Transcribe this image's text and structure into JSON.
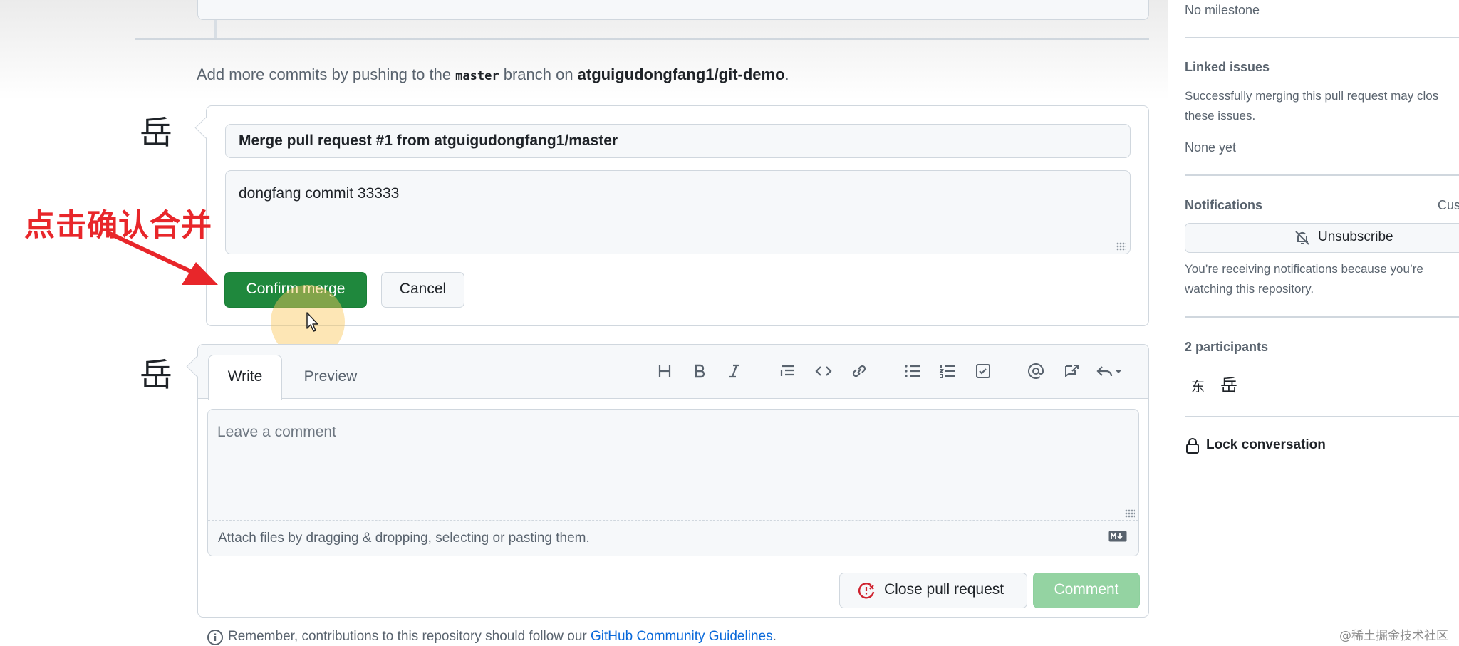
{
  "hint": {
    "prefix": "Add more commits by pushing to the ",
    "branch": "master",
    "middle": " branch on ",
    "repo": "atguigudongfang1/git-demo",
    "suffix": "."
  },
  "avatars": {
    "merge_author": "岳",
    "comment_author": "岳"
  },
  "annotation": {
    "text": "点击确认合并",
    "color": "#e8262a"
  },
  "merge": {
    "title_value": "Merge pull request #1 from atguigudongfang1/master",
    "message_value": "dongfang commit 33333",
    "confirm_label": "Confirm merge",
    "cancel_label": "Cancel"
  },
  "comment": {
    "tabs": [
      "Write",
      "Preview"
    ],
    "active_tab": "Write",
    "toolbar_icons": [
      "heading-icon",
      "bold-icon",
      "italic-icon",
      "quote-icon",
      "code-icon",
      "link-icon",
      "unordered-list-icon",
      "ordered-list-icon",
      "task-list-icon",
      "mention-icon",
      "reference-icon",
      "reply-icon"
    ],
    "placeholder": "Leave a comment",
    "attach_text": "Attach files by dragging & dropping, selecting or pasting them.",
    "close_pr_label": "Close pull request",
    "comment_label": "Comment"
  },
  "remember": {
    "text": "Remember, contributions to this repository should follow our ",
    "link": "GitHub Community Guidelines",
    "suffix": "."
  },
  "sidebar": {
    "milestone": "No milestone",
    "linked_issues_title": "Linked issues",
    "linked_issues_desc_1": "Successfully merging this pull request may clos",
    "linked_issues_desc_2": "these issues.",
    "linked_issues_value": "None yet",
    "notifications_title": "Notifications",
    "notifications_customize": "Cust",
    "unsubscribe_label": "Unsubscribe",
    "notification_reason_1": "You’re receiving notifications because you’re",
    "notification_reason_2": "watching this repository.",
    "participants_title": "2 participants",
    "participants": [
      "东",
      "岳"
    ],
    "lock_label": "Lock conversation"
  },
  "watermark": "@稀土掘金技术社区",
  "colors": {
    "primary_green": "#1f883d",
    "disabled_green": "#94d3a2",
    "link_blue": "#0969da",
    "close_red": "#cf222e"
  }
}
